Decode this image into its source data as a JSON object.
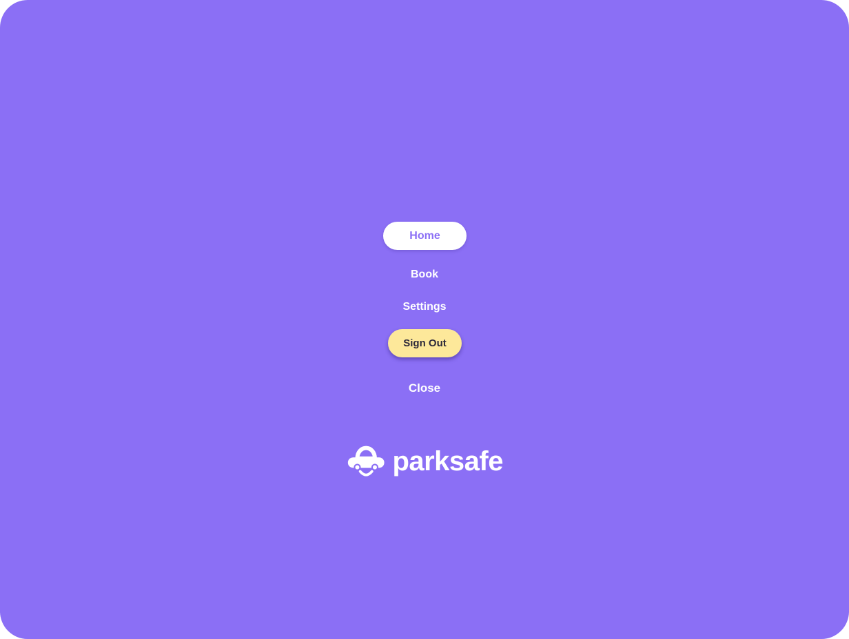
{
  "menu": {
    "home_label": "Home",
    "book_label": "Book",
    "settings_label": "Settings",
    "signout_label": "Sign Out",
    "close_label": "Close"
  },
  "brand": {
    "name": "parksafe",
    "logo_icon": "smiling-car-icon"
  },
  "colors": {
    "background": "#8b6ff5",
    "active_pill": "#ffffff",
    "signout_pill": "#fde89a",
    "text_light": "#ffffff",
    "text_dark": "#2e2a3a"
  }
}
